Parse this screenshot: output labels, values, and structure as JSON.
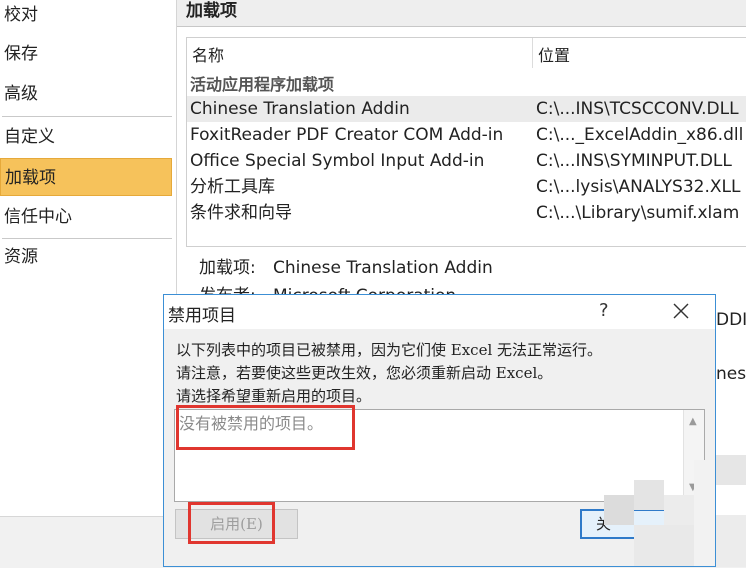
{
  "sidebar": {
    "items": [
      "校对",
      "保存",
      "高级",
      "自定义",
      "加载项",
      "信任中心",
      "资源"
    ],
    "active_index": 4
  },
  "main": {
    "title": "加载项",
    "columns": {
      "name": "名称",
      "location": "位置"
    },
    "group": "活动应用程序加载项",
    "rows": [
      {
        "name": "Chinese Translation Addin",
        "location": "C:\\...INS\\TCSCCONV.DLL"
      },
      {
        "name": "FoxitReader PDF Creator COM Add-in",
        "location": "C:\\..._ExcelAddin_x86.dll"
      },
      {
        "name": "Office Special Symbol Input Add-in",
        "location": "C:\\...INS\\SYMINPUT.DLL"
      },
      {
        "name": "分析工具库",
        "location": "C:\\...lysis\\ANALYS32.XLL"
      },
      {
        "name": "条件求和向导",
        "location": "C:\\...\\Library\\sumif.xlam"
      }
    ],
    "selected_row": 0,
    "detail": {
      "addin_label": "加载项:",
      "addin_value": "Chinese Translation Addin",
      "publisher_label": "发布者:",
      "publisher_value": "Microsoft Corporation"
    },
    "right_edge": {
      "text1": "DDIN",
      "text2": "nese"
    }
  },
  "dialog": {
    "title": "禁用项目",
    "help": "?",
    "message_lines": [
      "以下列表中的项目已被禁用，因为它们使 Excel 无法正常运行。",
      "请注意，若要使这些更改生效，您必须重新启动 Excel。",
      "请选择希望重新启用的项目。"
    ],
    "empty_text": "没有被禁用的项目。",
    "enable_button": "启用(E)",
    "close_button": "关"
  },
  "colors": {
    "active_nav": "#f6c25b",
    "highlight": "#e0362f",
    "dialog_border": "#3c8fd5"
  }
}
